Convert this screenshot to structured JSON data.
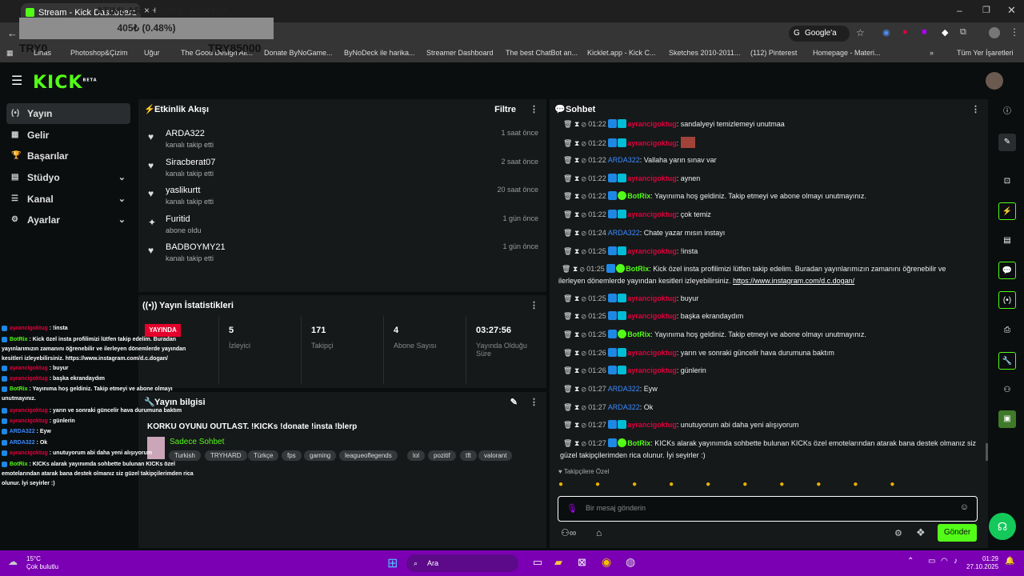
{
  "browser": {
    "tab_title": "Stream - Kick Dashboard",
    "address_action": "Google'a Sor",
    "all_bookmarks": "Tüm Yer İşaretleri",
    "bookmarks": [
      "Lirtas",
      "Photoshop&Çizim",
      "Uğur",
      "The Good Design All...",
      "Donate ByNoGame...",
      "ByNoDeck ile harika...",
      "Streamer Dashboard",
      "The best ChatBot an...",
      "Kicklet.app - Kick C...",
      "Sketches 2010-2011...",
      "(112) Pinterest",
      "Homepage - Materi..."
    ]
  },
  "overlay": {
    "banner": "405₺ (0.48%)",
    "left_label": "TRY0",
    "right_label": "TRY85000",
    "top_text": "ATIMLARI SEVİYE SİSTEM"
  },
  "logo": "KICK",
  "logo_beta": "BETA",
  "sidebar": {
    "items": [
      {
        "label": "Yayın",
        "icon": "(•)"
      },
      {
        "label": "Gelir",
        "icon": "▦"
      },
      {
        "label": "Başarılar",
        "icon": "🏆"
      },
      {
        "label": "Stüdyo",
        "icon": "▤"
      },
      {
        "label": "Kanal",
        "icon": "☰"
      },
      {
        "label": "Ayarlar",
        "icon": "⚙"
      }
    ]
  },
  "activity": {
    "title": "Etkinlik Akışı",
    "filter": "Filtre",
    "events": [
      {
        "name": "ARDA322",
        "desc": "kanalı takip etti",
        "time": "1 saat önce",
        "icon": "heart-icon"
      },
      {
        "name": "Siracberat07",
        "desc": "kanalı takip etti",
        "time": "2 saat önce",
        "icon": "heart-icon"
      },
      {
        "name": "yaslikurtt",
        "desc": "kanalı takip etti",
        "time": "20 saat önce",
        "icon": "heart-icon"
      },
      {
        "name": "Furitid",
        "desc": "abone oldu",
        "time": "1 gün önce",
        "icon": "star-icon"
      },
      {
        "name": "BADBOYMY21",
        "desc": "kanalı takip etti",
        "time": "1 gün önce",
        "icon": "heart-icon"
      }
    ]
  },
  "stats": {
    "title": "Yayın İstatistikleri",
    "live_badge": "YAYINDA",
    "items": [
      {
        "value": "5",
        "label": "İzleyici"
      },
      {
        "value": "171",
        "label": "Takipçi"
      },
      {
        "value": "4",
        "label": "Abone Sayısı"
      },
      {
        "value": "03:27:56",
        "label": "Yayında Olduğu Süre"
      }
    ]
  },
  "info": {
    "title": "Yayın bilgisi",
    "stream_title": "KORKU OYUNU OUTLAST. !KICKs !donate !insta !blerp",
    "category": "Sadece Sohbet",
    "tags": [
      "Turkish",
      "TRYHARD",
      "Türkçe",
      "fps",
      "gaming",
      "leagueoflegends",
      "lol",
      "pozitif",
      "tft",
      "valorant"
    ]
  },
  "chat": {
    "title": "Sohbet",
    "subscriber_label": "Takipçilere Özel",
    "placeholder": "Bir mesaj gönderin",
    "send": "Gönder",
    "messages": [
      {
        "time": "01:22",
        "user": "ayrancigoktug",
        "text": ": sandalyeyi temizlemeyi unutmaa",
        "type": "u"
      },
      {
        "time": "01:22",
        "user": "ayrancigoktug",
        "text": ":",
        "type": "u",
        "emote": true
      },
      {
        "time": "01:22",
        "user": "ARDA322",
        "text": ": Vallaha yarın sınav var",
        "type": "b"
      },
      {
        "time": "01:22",
        "user": "ayrancigoktug",
        "text": ": aynen",
        "type": "u"
      },
      {
        "time": "01:22",
        "user": "BotRix",
        "text": ": Yayınıma hoş geldiniz. Takip etmeyi ve abone olmayı unutmayınız.",
        "type": "g"
      },
      {
        "time": "01:22",
        "user": "ayrancigoktug",
        "text": ": çok temiz",
        "type": "u"
      },
      {
        "time": "01:24",
        "user": "ARDA322",
        "text": ": Chate yazar mısın instayı",
        "type": "b"
      },
      {
        "time": "01:25",
        "user": "ayrancigoktug",
        "text": ": !insta",
        "type": "u"
      },
      {
        "time": "01:25",
        "user": "BotRix",
        "text": ": Kick özel insta profilimizi lütfen takip edelim. Buradan yayınlarımızın zamanını öğrenebilir ve ilerleyen dönemlerde yayından kesitleri izleyebilirsiniz. ",
        "link": "https://www.instagram.com/d.c.dogan/",
        "type": "g"
      },
      {
        "time": "01:25",
        "user": "ayrancigoktug",
        "text": ": buyur",
        "type": "u"
      },
      {
        "time": "01:25",
        "user": "ayrancigoktug",
        "text": ": başka ekrandaydım",
        "type": "u"
      },
      {
        "time": "01:25",
        "user": "BotRix",
        "text": ": Yayınıma hoş geldiniz. Takip etmeyi ve abone olmayı unutmayınız.",
        "type": "g"
      },
      {
        "time": "01:26",
        "user": "ayrancigoktug",
        "text": ": yarın ve sonraki güncelir hava durumuna baktım",
        "type": "u"
      },
      {
        "time": "01:26",
        "user": "ayrancigoktug",
        "text": ": günlerin",
        "type": "u"
      },
      {
        "time": "01:27",
        "user": "ARDA322",
        "text": ": Eyw",
        "type": "b"
      },
      {
        "time": "01:27",
        "user": "ARDA322",
        "text": ": Ok",
        "type": "b"
      },
      {
        "time": "01:27",
        "user": "ayrancigoktug",
        "text": ": unutuyorum abi daha yeni alışıyorum",
        "type": "u"
      },
      {
        "time": "01:27",
        "user": "BotRix",
        "text": ": KICKs alarak yayınımda sohbette bulunan KICKs özel emotelarından atarak bana destek olmanız siz güzel takipçilerimden rica olunur. İyi seyirler :)",
        "type": "g"
      }
    ]
  },
  "overlay_chat": [
    {
      "u": "ayrancigoktug",
      "t": " : !insta",
      "c": "u"
    },
    {
      "u": "BotRix",
      "t": " : Kick özel insta profilimizi lütfen takip edelim. Buradan yayınlarımızın zamanını öğrenebilir ve ilerleyen dönemlerde yayından kesitleri izleyebilirsiniz. https://www.instagram.com/d.c.dogan/",
      "c": "g"
    },
    {
      "u": "ayrancigoktug",
      "t": " : buyur",
      "c": "u"
    },
    {
      "u": "ayrancigoktug",
      "t": " : başka ekrandaydım",
      "c": "u"
    },
    {
      "u": "BotRix",
      "t": " : Yayınıma hoş geldiniz. Takip etmeyi ve abone olmayı unutmayınız.",
      "c": "g"
    },
    {
      "u": "ayrancigoktug",
      "t": " : yarın ve sonraki güncelir hava durumuna baktım",
      "c": "u"
    },
    {
      "u": "ayrancigoktug",
      "t": " : günlerin",
      "c": "u"
    },
    {
      "u": "ARDA322",
      "t": " : Eyw",
      "c": "b"
    },
    {
      "u": "ARDA322",
      "t": " : Ok",
      "c": "b"
    },
    {
      "u": "ayrancigoktug",
      "t": " : unutuyorum abi daha yeni alışıyorum",
      "c": "u"
    },
    {
      "u": "BotRix",
      "t": " : KICKs alarak yayınımda sohbette bulunan KICKs özel emotelarından atarak bana destek olmanız siz güzel takipçilerimden rica olunur. İyi seyirler :)",
      "c": "g"
    }
  ],
  "taskbar": {
    "temp": "15°C",
    "weather": "Çok bulutlu",
    "search": "Ara",
    "time": "01:29",
    "date": "27.10.2025"
  },
  "colors": {
    "accent": "#53fc18",
    "taskbar": "#7b00b3",
    "chat_user": "#e0003c",
    "chat_user2": "#3b8bff"
  }
}
